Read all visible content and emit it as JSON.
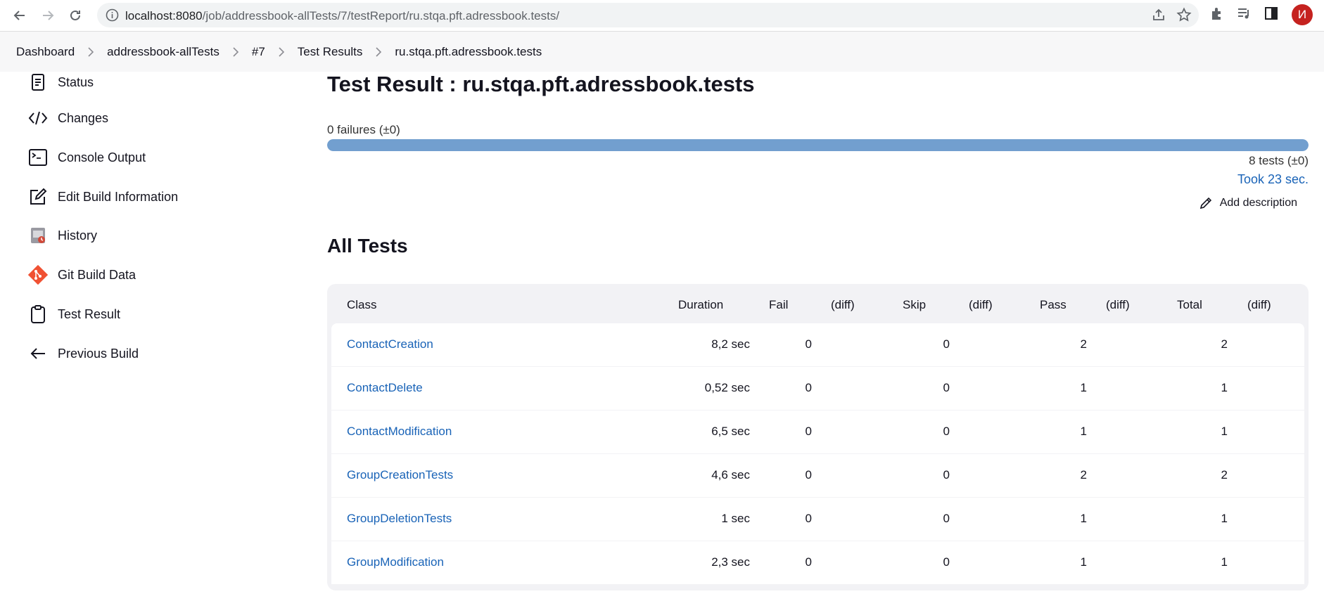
{
  "browser": {
    "url_host": "localhost:8080",
    "url_path": "/job/addressbook-allTests/7/testReport/ru.stqa.pft.adressbook.tests/",
    "profile_initial": "И"
  },
  "breadcrumb": [
    "Dashboard",
    "addressbook-allTests",
    "#7",
    "Test Results",
    "ru.stqa.pft.adressbook.tests"
  ],
  "sidebar": {
    "items": [
      {
        "label": "Status",
        "icon": "document-icon"
      },
      {
        "label": "Changes",
        "icon": "code-icon"
      },
      {
        "label": "Console Output",
        "icon": "terminal-icon"
      },
      {
        "label": "Edit Build Information",
        "icon": "edit-icon"
      },
      {
        "label": "History",
        "icon": "history-icon"
      },
      {
        "label": "Git Build Data",
        "icon": "git-icon"
      },
      {
        "label": "Test Result",
        "icon": "clipboard-icon"
      },
      {
        "label": "Previous Build",
        "icon": "arrow-left-icon"
      }
    ]
  },
  "main": {
    "title": "Test Result : ru.stqa.pft.adressbook.tests",
    "failures": "0 failures (±0)",
    "progress_pass_fraction": 1.0,
    "tests_count": "8 tests (±0)",
    "took": "Took 23 sec.",
    "add_description": "Add description",
    "section_title": "All Tests"
  },
  "table": {
    "headers": [
      "Class",
      "Duration",
      "Fail",
      "(diff)",
      "Skip",
      "(diff)",
      "Pass",
      "(diff)",
      "Total",
      "(diff)"
    ],
    "rows": [
      {
        "cls": "ContactCreation",
        "duration": "8,2 sec",
        "fail": "0",
        "skip": "0",
        "pass": "2",
        "total": "2"
      },
      {
        "cls": "ContactDelete",
        "duration": "0,52 sec",
        "fail": "0",
        "skip": "0",
        "pass": "1",
        "total": "1"
      },
      {
        "cls": "ContactModification",
        "duration": "6,5 sec",
        "fail": "0",
        "skip": "0",
        "pass": "1",
        "total": "1"
      },
      {
        "cls": "GroupCreationTests",
        "duration": "4,6 sec",
        "fail": "0",
        "skip": "0",
        "pass": "2",
        "total": "2"
      },
      {
        "cls": "GroupDeletionTests",
        "duration": "1 sec",
        "fail": "0",
        "skip": "0",
        "pass": "1",
        "total": "1"
      },
      {
        "cls": "GroupModification",
        "duration": "2,3 sec",
        "fail": "0",
        "skip": "0",
        "pass": "1",
        "total": "1"
      }
    ]
  }
}
